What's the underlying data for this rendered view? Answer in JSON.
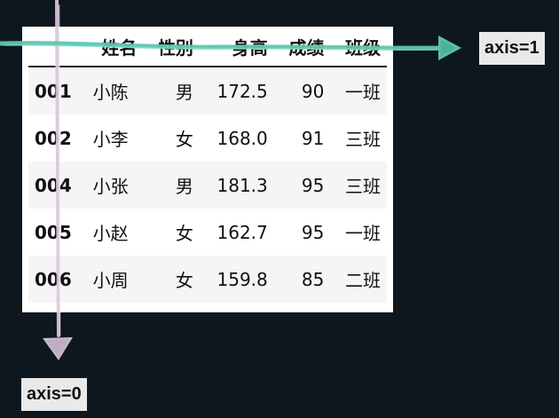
{
  "table": {
    "columns": [
      "",
      "姓名",
      "性别",
      "身高",
      "成绩",
      "班级"
    ],
    "rows": [
      {
        "index": "001",
        "name": "小陈",
        "gender": "男",
        "height": "172.5",
        "score": "90",
        "class": "一班"
      },
      {
        "index": "002",
        "name": "小李",
        "gender": "女",
        "height": "168.0",
        "score": "91",
        "class": "三班"
      },
      {
        "index": "004",
        "name": "小张",
        "gender": "男",
        "height": "181.3",
        "score": "95",
        "class": "三班"
      },
      {
        "index": "005",
        "name": "小赵",
        "gender": "女",
        "height": "162.7",
        "score": "95",
        "class": "一班"
      },
      {
        "index": "006",
        "name": "小周",
        "gender": "女",
        "height": "159.8",
        "score": "85",
        "class": "二班"
      }
    ]
  },
  "axis_labels": {
    "axis1": "axis=1",
    "axis0": "axis=0"
  },
  "colors": {
    "background": "#0f171e",
    "axis1_arrow": "#5cc8b0",
    "axis0_arrow": "#d9c6dd"
  }
}
